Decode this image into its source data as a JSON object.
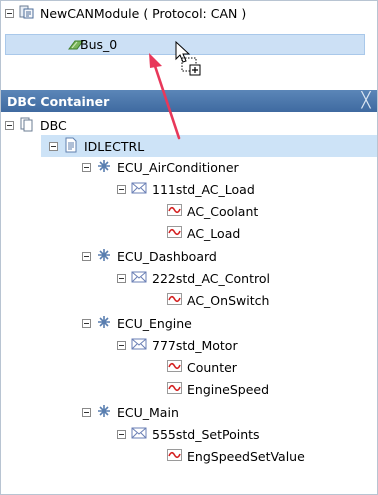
{
  "top_tree": {
    "module_label": "NewCANModule ( Protocol: CAN )",
    "bus_label": "Bus_0"
  },
  "dbc_container": {
    "title": "DBC Container",
    "close_glyph": "╳",
    "root_label": "DBC",
    "node_label": "IDLECTRL",
    "ecus": [
      {
        "label": "ECU_AirConditioner",
        "message": "111std_AC_Load",
        "signals": [
          "AC_Coolant",
          "AC_Load"
        ]
      },
      {
        "label": "ECU_Dashboard",
        "message": "222std_AC_Control",
        "signals": [
          "AC_OnSwitch"
        ]
      },
      {
        "label": "ECU_Engine",
        "message": "777std_Motor",
        "signals": [
          "Counter",
          "EngineSpeed"
        ]
      },
      {
        "label": "ECU_Main",
        "message": "555std_SetPoints",
        "signals": [
          "EngSpeedSetValue"
        ]
      }
    ]
  },
  "colors": {
    "header": "#4a76ab",
    "selection": "#cde3f7",
    "drag_arrow": "#e8385a",
    "signal_icon": "#d42020",
    "envelope_icon": "#6a7fb5"
  },
  "icons": {
    "module": "module-icon",
    "bus": "bus-icon",
    "document": "document-icon",
    "database": "database-icon",
    "ecu": "ecu-icon",
    "message": "envelope-icon",
    "signal": "signal-icon",
    "drag_cursor": "drag-copy-cursor-icon"
  }
}
